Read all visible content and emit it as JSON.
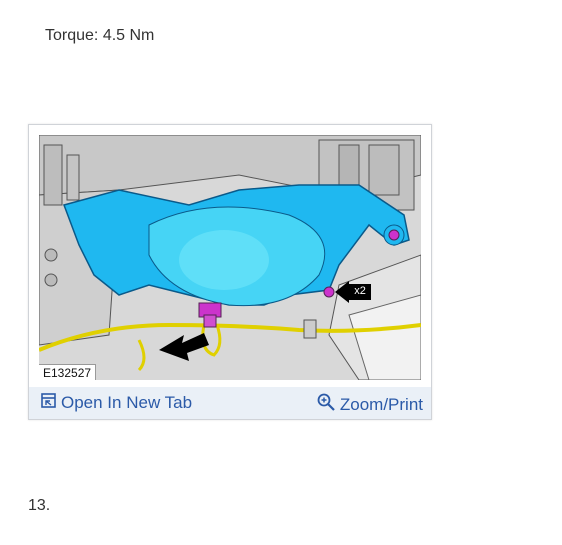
{
  "torque": {
    "text": "Torque: 4.5 Nm"
  },
  "figure": {
    "code": "E132527",
    "callout": "x2",
    "open_tab_label": "Open In New Tab",
    "zoom_label": "Zoom/Print",
    "open_tab_icon": "open-new-tab-icon",
    "zoom_icon": "magnifier-plus-icon",
    "link_color": "#2b5aa8",
    "part_color": "#1fb8f0",
    "bolt_color": "#cc33cc",
    "wire_color": "#e0d000"
  },
  "step": {
    "number": "13."
  }
}
